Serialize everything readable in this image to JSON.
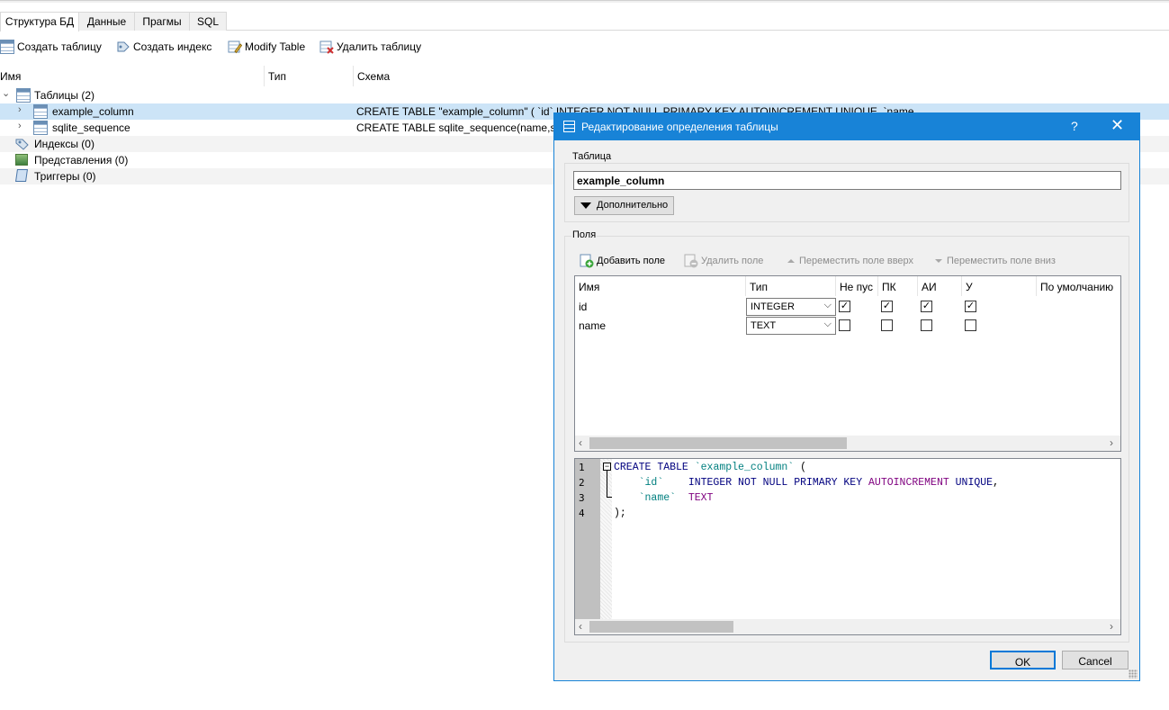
{
  "main": {
    "tabs": [
      {
        "label": "Структура БД",
        "active": true
      },
      {
        "label": "Данные"
      },
      {
        "label": "Прагмы"
      },
      {
        "label": "SQL"
      }
    ],
    "toolbar": {
      "create_table": "Создать таблицу",
      "create_index": "Создать индекс",
      "modify_table": "Modify Table",
      "delete_table": "Удалить таблицу"
    },
    "tree_columns": [
      "Имя",
      "Тип",
      "Схема"
    ],
    "tree": {
      "tables": "Таблицы (2)",
      "row1": {
        "name": "example_column",
        "schema": "CREATE TABLE \"example_column\" ( `id` INTEGER NOT NULL PRIMARY KEY AUTOINCREMENT UNIQUE, `name` TEXT )"
      },
      "row2": {
        "name": "sqlite_sequence",
        "schema": "CREATE TABLE sqlite_sequence(name,seq)"
      },
      "indexes": "Индексы (0)",
      "views": "Представления (0)",
      "triggers": "Триггеры (0)"
    }
  },
  "dialog": {
    "title": "Редактирование определения таблицы",
    "help": "?",
    "close": "✕",
    "table_group": "Таблица",
    "table_name": "example_column",
    "advanced": "Дополнительно",
    "fields_group": "Поля",
    "add_field": "Добавить поле",
    "remove_field": "Удалить поле",
    "move_up": "Переместить поле вверх",
    "move_down": "Переместить поле вниз",
    "columns": [
      "Имя",
      "Тип",
      "Не пус",
      "ПК",
      "АИ",
      "У",
      "По умолчанию"
    ],
    "fields": [
      {
        "name": "id",
        "type": "INTEGER",
        "notnull": true,
        "pk": true,
        "ai": true,
        "unique": true
      },
      {
        "name": "name",
        "type": "TEXT",
        "notnull": false,
        "pk": false,
        "ai": false,
        "unique": false
      }
    ],
    "sql_lines": [
      "1",
      "2",
      "3",
      "4"
    ],
    "ok": "OK",
    "cancel": "Cancel"
  }
}
